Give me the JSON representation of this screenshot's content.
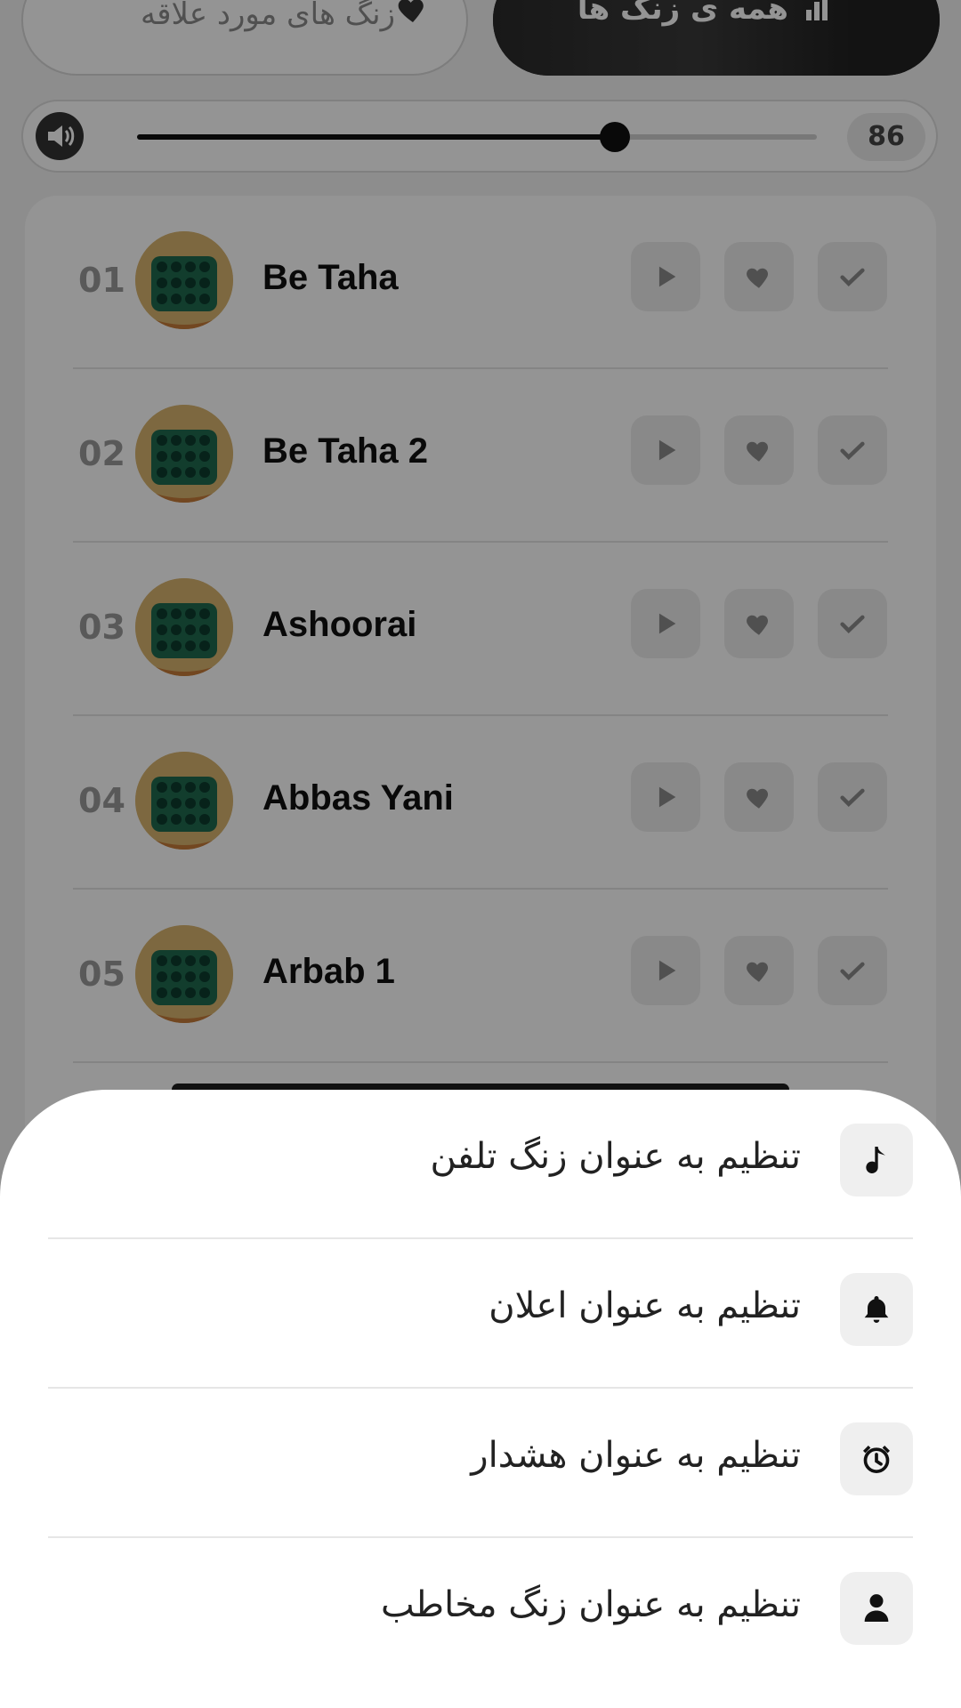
{
  "tabs": {
    "favorites_label": "زنگ های مورد علاقه",
    "all_label": "همه ی زنگ ها"
  },
  "volume": {
    "value": "86",
    "level_percent": 86
  },
  "ringtones": [
    {
      "number": "01",
      "title": "Be Taha"
    },
    {
      "number": "02",
      "title": "Be Taha 2"
    },
    {
      "number": "03",
      "title": "Ashoorai"
    },
    {
      "number": "04",
      "title": "Abbas Yani"
    },
    {
      "number": "05",
      "title": "Arbab 1"
    }
  ],
  "sheet": {
    "options": [
      {
        "label": "تنظیم به عنوان زنگ تلفن",
        "icon": "music-note-icon"
      },
      {
        "label": "تنظیم به عنوان اعلان",
        "icon": "bell-icon"
      },
      {
        "label": "تنظیم به عنوان هشدار",
        "icon": "alarm-clock-icon"
      },
      {
        "label": "تنظیم به عنوان زنگ مخاطب",
        "icon": "person-icon"
      }
    ]
  },
  "colors": {
    "overlay": "#000000",
    "accent": "#111111",
    "sheet_bg": "#ffffff"
  }
}
